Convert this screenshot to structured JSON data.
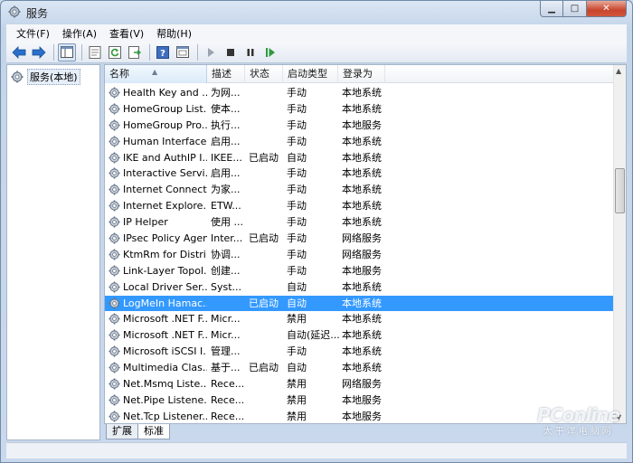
{
  "window": {
    "title": "服务"
  },
  "menu": [
    "文件(F)",
    "操作(A)",
    "查看(V)",
    "帮助(H)"
  ],
  "tree": {
    "root": "服务(本地)"
  },
  "columns": [
    "名称",
    "描述",
    "状态",
    "启动类型",
    "登录为"
  ],
  "rows": [
    {
      "name": "Health Key and ...",
      "desc": "为网...",
      "status": "",
      "start": "手动",
      "logon": "本地系统"
    },
    {
      "name": "HomeGroup List...",
      "desc": "使本...",
      "status": "",
      "start": "手动",
      "logon": "本地系统"
    },
    {
      "name": "HomeGroup Pro...",
      "desc": "执行...",
      "status": "",
      "start": "手动",
      "logon": "本地服务"
    },
    {
      "name": "Human Interface...",
      "desc": "启用...",
      "status": "",
      "start": "手动",
      "logon": "本地系统"
    },
    {
      "name": "IKE and AuthIP I...",
      "desc": "IKEE...",
      "status": "已启动",
      "start": "自动",
      "logon": "本地系统"
    },
    {
      "name": "Interactive Servi...",
      "desc": "启用...",
      "status": "",
      "start": "手动",
      "logon": "本地系统"
    },
    {
      "name": "Internet Connect...",
      "desc": "为家...",
      "status": "",
      "start": "手动",
      "logon": "本地系统"
    },
    {
      "name": "Internet Explore...",
      "desc": "ETW...",
      "status": "",
      "start": "手动",
      "logon": "本地系统"
    },
    {
      "name": "IP Helper",
      "desc": "使用 ...",
      "status": "",
      "start": "手动",
      "logon": "本地系统"
    },
    {
      "name": "IPsec Policy Agent",
      "desc": "Inter...",
      "status": "已启动",
      "start": "手动",
      "logon": "网络服务"
    },
    {
      "name": "KtmRm for Distri...",
      "desc": "协调...",
      "status": "",
      "start": "手动",
      "logon": "网络服务"
    },
    {
      "name": "Link-Layer Topol...",
      "desc": "创建...",
      "status": "",
      "start": "手动",
      "logon": "本地服务"
    },
    {
      "name": "Local Driver Ser...",
      "desc": "Syst...",
      "status": "",
      "start": "自动",
      "logon": "本地系统"
    },
    {
      "name": "LogMeIn Hamac...",
      "desc": "",
      "status": "已启动",
      "start": "自动",
      "logon": "本地系统",
      "selected": true
    },
    {
      "name": "Microsoft .NET F...",
      "desc": "Micr...",
      "status": "",
      "start": "禁用",
      "logon": "本地系统"
    },
    {
      "name": "Microsoft .NET F...",
      "desc": "Micr...",
      "status": "",
      "start": "自动(延迟...",
      "logon": "本地系统"
    },
    {
      "name": "Microsoft iSCSI I...",
      "desc": "管理...",
      "status": "",
      "start": "手动",
      "logon": "本地系统"
    },
    {
      "name": "Multimedia Clas...",
      "desc": "基于...",
      "status": "已启动",
      "start": "自动",
      "logon": "本地系统"
    },
    {
      "name": "Net.Msmq Liste...",
      "desc": "Rece...",
      "status": "",
      "start": "禁用",
      "logon": "网络服务"
    },
    {
      "name": "Net.Pipe Listene...",
      "desc": "Rece...",
      "status": "",
      "start": "禁用",
      "logon": "本地服务"
    },
    {
      "name": "Net.Tcp Listener...",
      "desc": "Rece...",
      "status": "",
      "start": "禁用",
      "logon": "本地服务"
    }
  ],
  "tabs": [
    "扩展",
    "标准"
  ],
  "active_tab": "标准",
  "watermark": {
    "brand": "PConline",
    "cn": "太平洋电脑网"
  },
  "colors": {
    "selection": "#3399ff",
    "accent": "#2a6fc9"
  },
  "icons": {
    "title": "services-gear-icon",
    "toolbar": [
      "back-arrow-icon",
      "forward-arrow-icon",
      "show-hide-console-tree-icon",
      "properties-icon",
      "refresh-icon",
      "export-list-icon",
      "help-icon",
      "console-view-icon",
      "start-service-icon",
      "stop-service-icon",
      "pause-service-icon",
      "restart-service-icon"
    ],
    "row": "service-gear-icon"
  }
}
